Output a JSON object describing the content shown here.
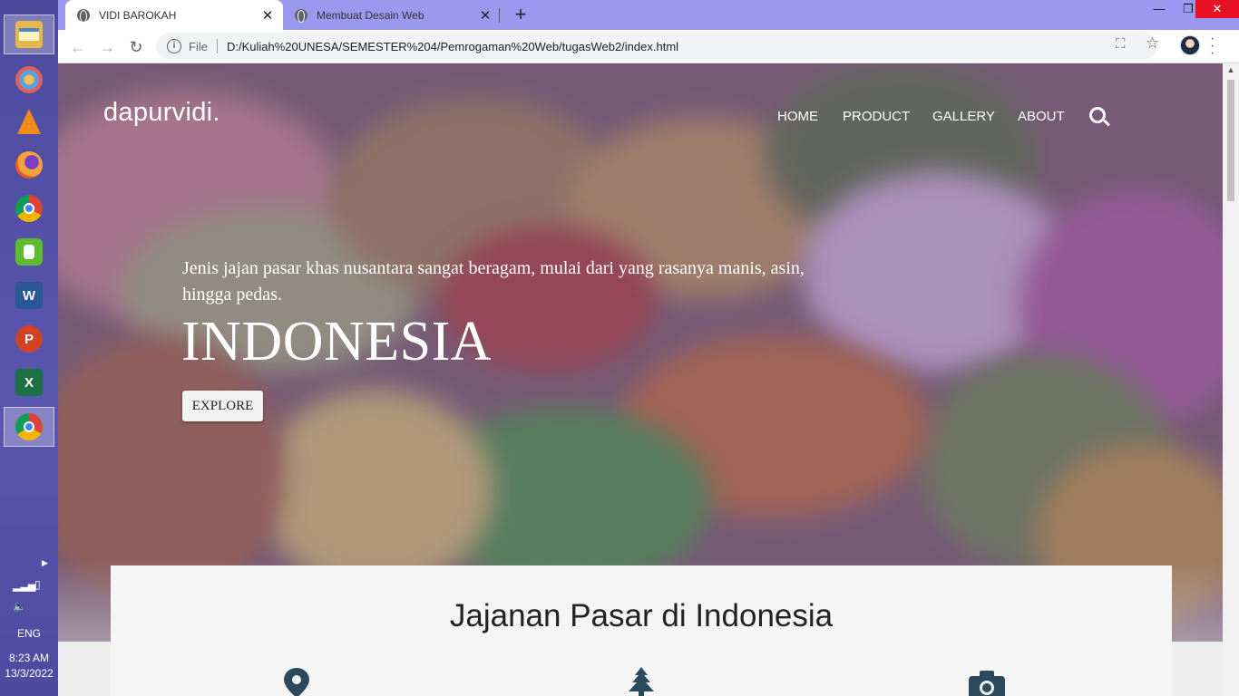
{
  "taskbar": {
    "apps": [
      {
        "name": "file-explorer-icon",
        "color": "#e6b84a",
        "active": true
      },
      {
        "name": "paint-icon",
        "color": "#5aa0e0"
      },
      {
        "name": "vlc-icon",
        "color": "#f08a1c"
      },
      {
        "name": "firefox-icon",
        "color": "#e8572a"
      },
      {
        "name": "chrome-icon",
        "color": "#3c8f3c"
      },
      {
        "name": "evernote-icon",
        "color": "#5dbb2f"
      },
      {
        "name": "word-icon",
        "color": "#2b5797",
        "glyph": "W"
      },
      {
        "name": "powerpoint-icon",
        "color": "#d04423",
        "glyph": "P"
      },
      {
        "name": "excel-icon",
        "color": "#1e7145",
        "glyph": "X"
      },
      {
        "name": "chrome-profile-icon",
        "color": "#3c8f3c",
        "active": true
      }
    ],
    "tray": {
      "language": "ENG",
      "time": "8:23 AM",
      "date": "13/3/2022"
    }
  },
  "browser": {
    "tabs": [
      {
        "title": "VIDI BAROKAH",
        "active": true
      },
      {
        "title": "Membuat Desain Web",
        "active": false
      }
    ],
    "address": {
      "scheme": "File",
      "url": "D:/Kuliah%20UNESA/SEMESTER%204/Pemrogaman%20Web/tugasWeb2/index.html"
    }
  },
  "page": {
    "brand": "dapurvidi.",
    "nav": [
      "HOME",
      "PRODUCT",
      "GALLERY",
      "ABOUT"
    ],
    "hero": {
      "tagline": "Jenis jajan pasar khas nusantara sangat beragam, mulai dari yang rasanya manis, asin, hingga pedas.",
      "headline": "INDONESIA",
      "button": "EXPLORE"
    },
    "section": {
      "title": "Jajanan Pasar di Indonesia",
      "icons": [
        "map-marker-icon",
        "tree-icon",
        "camera-icon"
      ]
    }
  },
  "colors": {
    "tabstrip": "#9b98ef",
    "taskbar": "#5a56b0",
    "icon_dark": "#2c4a5e"
  }
}
